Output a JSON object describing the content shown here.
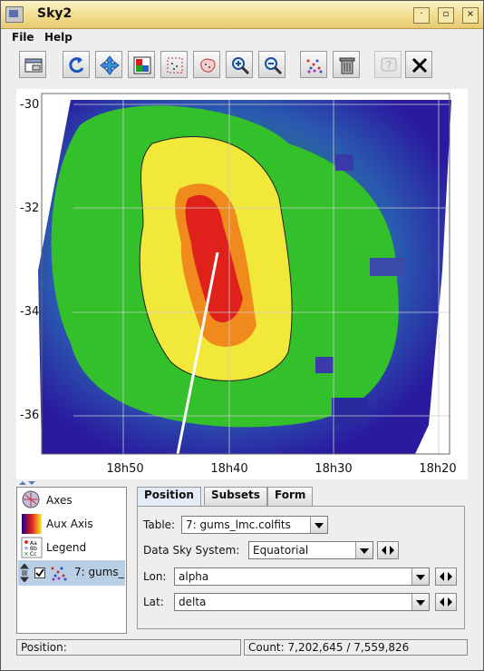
{
  "window": {
    "title": "Sky2"
  },
  "menubar": {
    "items": [
      {
        "label": "File"
      },
      {
        "label": "Help"
      }
    ]
  },
  "toolbar": {
    "buttons": [
      {
        "icon": "window-icon"
      },
      {
        "icon": "replot-icon"
      },
      {
        "icon": "pan-icon"
      },
      {
        "icon": "export-image-icon"
      },
      {
        "icon": "blob-subset-icon"
      },
      {
        "icon": "region-subset-icon"
      },
      {
        "icon": "zoom-in-icon"
      },
      {
        "icon": "zoom-out-icon"
      },
      {
        "icon": "scatter-points-icon"
      },
      {
        "icon": "delete-icon"
      },
      {
        "icon": "help-icon"
      },
      {
        "icon": "close-icon"
      }
    ]
  },
  "plot": {
    "y_ticks": [
      "-30",
      "-32",
      "-34",
      "-36"
    ],
    "x_ticks": [
      "18h50",
      "18h40",
      "18h30",
      "18h20"
    ],
    "colors": {
      "low": "#2a1aa0",
      "mid": "#20c020",
      "high": "#f2e83a",
      "peak": "#e0201a"
    }
  },
  "layers": {
    "items": [
      {
        "label": "Axes",
        "icon": "axes-icon"
      },
      {
        "label": "Aux Axis",
        "icon": "aux-axis-icon"
      },
      {
        "label": "Legend",
        "icon": "legend-icon"
      }
    ],
    "selected": {
      "label": "7: gums_",
      "checked": true
    }
  },
  "controls": {
    "tabs": [
      {
        "label": "Position"
      },
      {
        "label": "Subsets"
      },
      {
        "label": "Form"
      }
    ],
    "table_label": "Table:",
    "table_value": "7: gums_lmc.colfits",
    "sky_system_label": "Data Sky System:",
    "sky_system_value": "Equatorial",
    "lon_label": "Lon:",
    "lon_value": "alpha",
    "lat_label": "Lat:",
    "lat_value": "delta"
  },
  "status": {
    "position_label": "Position:",
    "count_text": "Count: 7,202,645 / 7,559,826"
  }
}
